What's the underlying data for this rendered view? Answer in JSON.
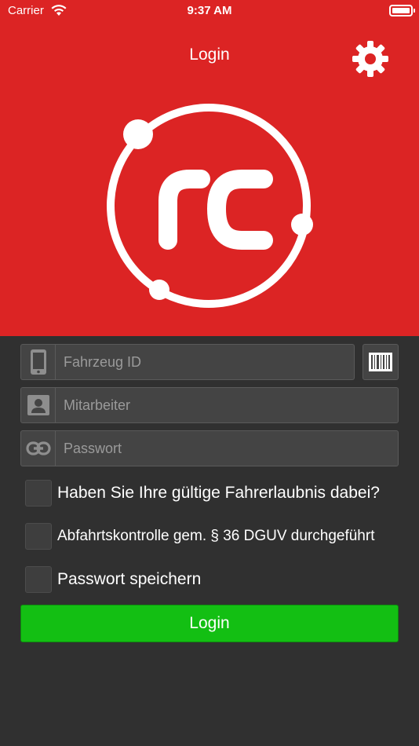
{
  "status_bar": {
    "carrier": "Carrier",
    "time": "9:37 AM"
  },
  "nav": {
    "title": "Login",
    "settings_icon": "gear-icon"
  },
  "logo": {
    "text": "rc"
  },
  "form": {
    "vehicle_id": {
      "placeholder": "Fahrzeug ID",
      "value": "",
      "icon": "phone-icon"
    },
    "employee": {
      "placeholder": "Mitarbeiter",
      "value": "",
      "icon": "person-icon"
    },
    "password": {
      "placeholder": "Passwort",
      "value": "",
      "icon": "link-icon"
    },
    "barcode_icon": "barcode-icon"
  },
  "checks": [
    {
      "label": "Haben Sie Ihre gültige Fahrerlaubnis dabei?",
      "checked": false
    },
    {
      "label": "Abfahrtskontrolle gem. § 36 DGUV durchgeführt",
      "checked": false
    },
    {
      "label": "Passwort speichern",
      "checked": false
    }
  ],
  "login_button": {
    "label": "Login"
  },
  "colors": {
    "brand_red": "#dc2424",
    "background": "#303030",
    "login_green": "#13bf13"
  }
}
